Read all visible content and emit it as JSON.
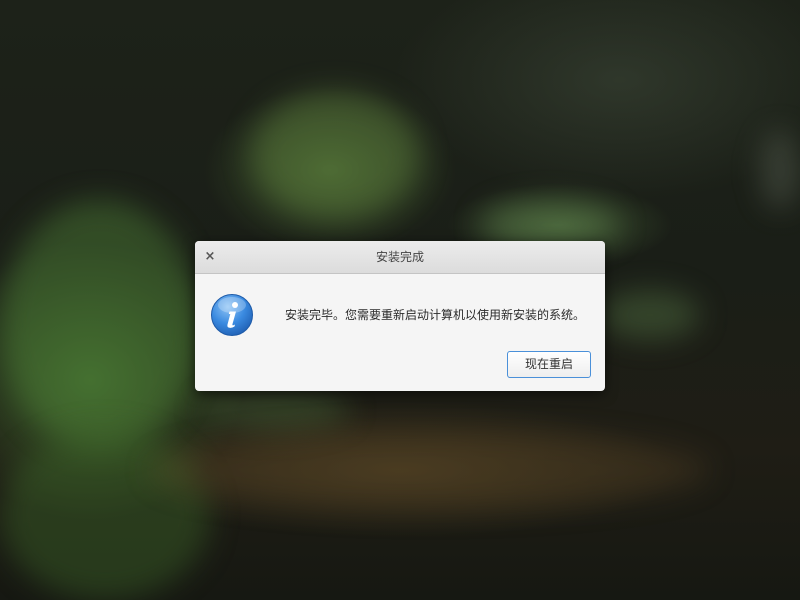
{
  "dialog": {
    "title": "安装完成",
    "close_glyph": "×",
    "message": "安装完毕。您需要重新启动计算机以使用新安装的系统。",
    "button_label": "现在重启",
    "icon": "info-icon"
  },
  "colors": {
    "accent": "#4a90d9",
    "icon_blue": "#2f7fd8"
  }
}
